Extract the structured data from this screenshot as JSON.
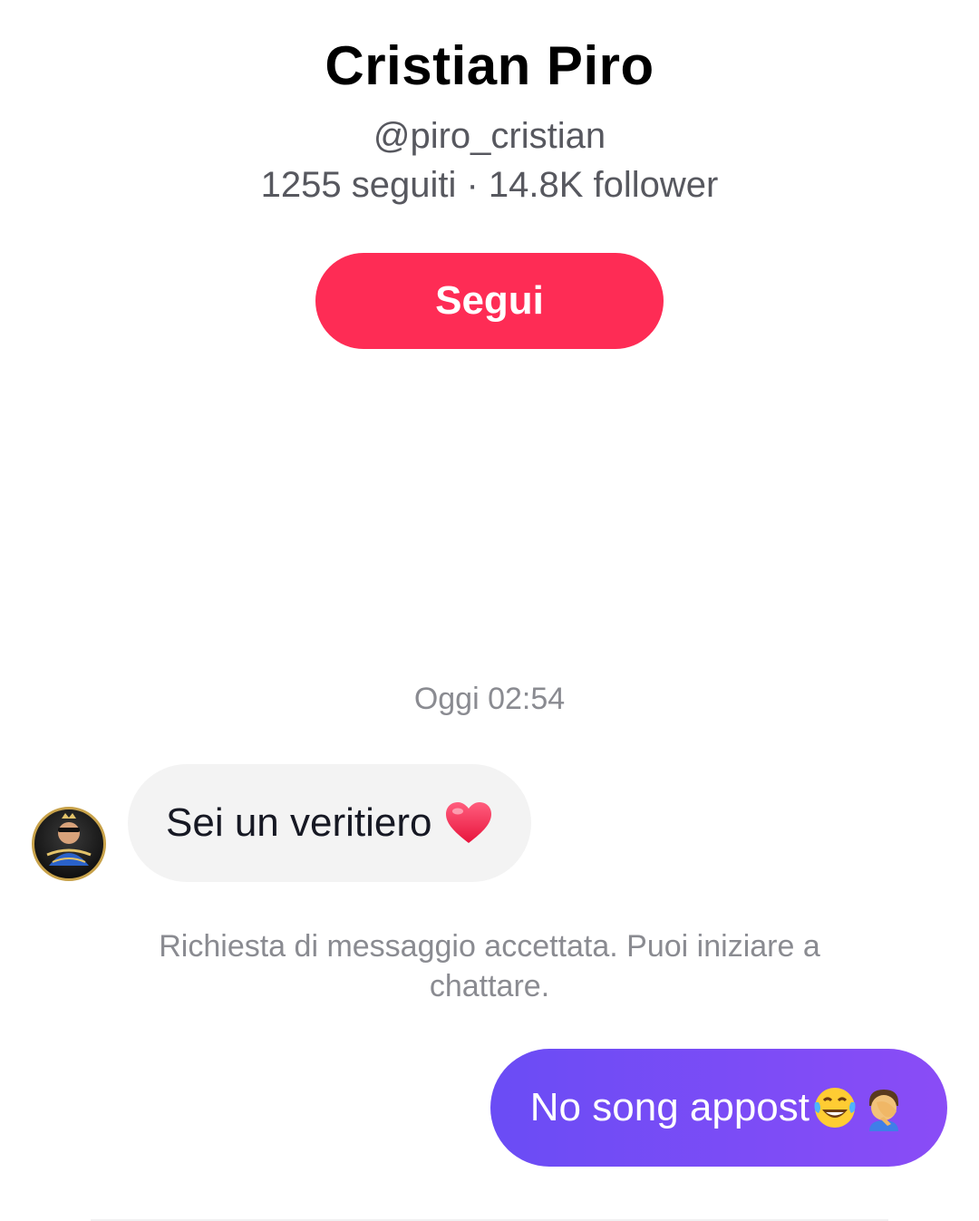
{
  "profile": {
    "name": "Cristian Piro",
    "handle": "@piro_cristian",
    "stats": "1255 seguiti · 14.8K follower",
    "follow_label": "Segui"
  },
  "chat": {
    "timestamp": "Oggi 02:54",
    "incoming_message": "Sei un veritiero",
    "incoming_emoji": "heart-icon",
    "system_note": "Richiesta di messaggio accettata. Puoi iniziare a chattare.",
    "outgoing_message": "No song appost",
    "outgoing_emojis": [
      "tears-of-joy-icon",
      "facepalm-icon"
    ]
  },
  "colors": {
    "follow_button": "#fe2c55",
    "outgoing_bubble": "#7b4cf5",
    "incoming_bubble": "#f3f3f3"
  }
}
